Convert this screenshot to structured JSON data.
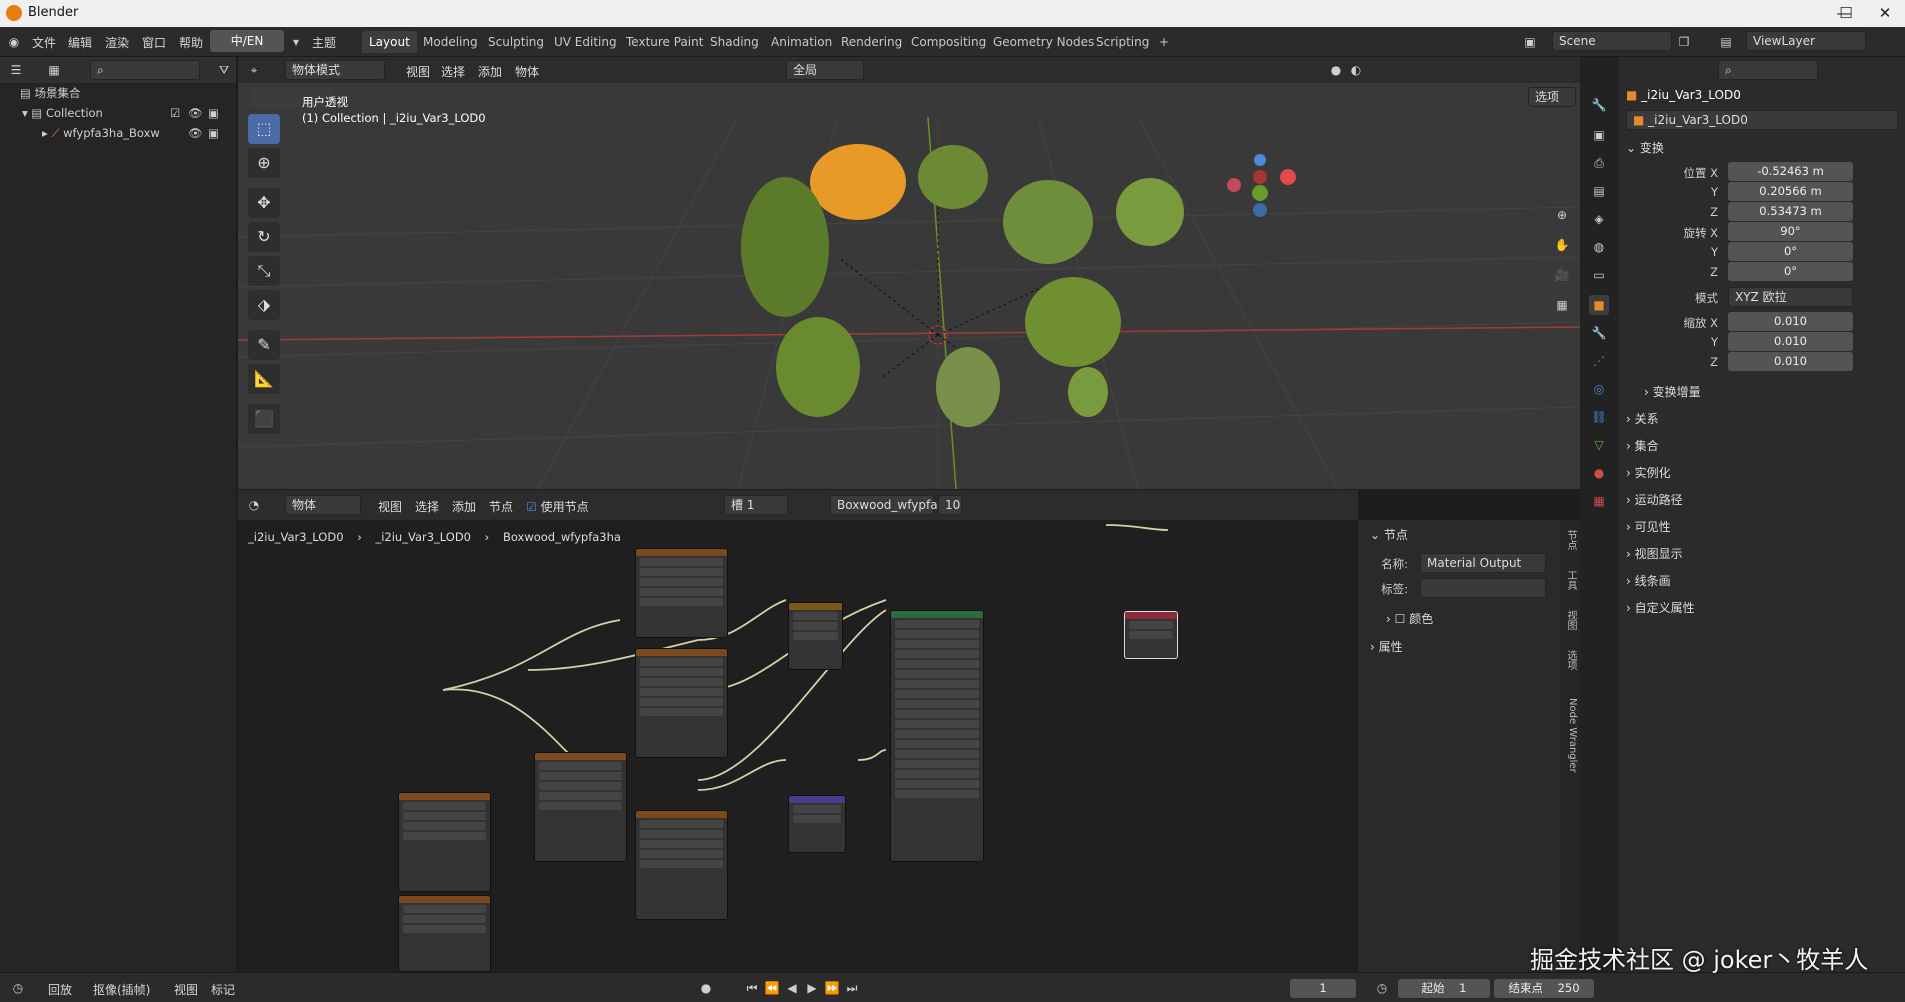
{
  "app": {
    "title": "Blender",
    "minimize": "—",
    "maximize": "☐",
    "close": "✕"
  },
  "menus": [
    "文件",
    "编辑",
    "渲染",
    "窗口",
    "帮助"
  ],
  "lang_button": "中/EN",
  "theme_menu": "主题",
  "workspaces": [
    "Layout",
    "Modeling",
    "Sculpting",
    "UV Editing",
    "Texture Paint",
    "Shading",
    "Animation",
    "Rendering",
    "Compositing",
    "Geometry Nodes",
    "Scripting"
  ],
  "add_tab": "+",
  "scene": {
    "name": "Scene",
    "view_layer": "ViewLayer"
  },
  "outliner": {
    "root": "场景集合",
    "collection": "Collection",
    "object": "wfypfa3ha_Boxw"
  },
  "viewport": {
    "mode": "物体模式",
    "menus": [
      "视图",
      "选择",
      "添加",
      "物体"
    ],
    "transform_orient": "全局",
    "options": "选项",
    "overlay_title": "用户透视",
    "overlay_sub": "(1) Collection | _i2iu_Var3_LOD0",
    "tools": [
      "select",
      "cursor",
      "move",
      "rotate",
      "scale",
      "transform",
      "annotate",
      "measure",
      "add-cube"
    ]
  },
  "node_editor": {
    "type": "物体",
    "menus": [
      "视图",
      "选择",
      "添加",
      "节点"
    ],
    "use_nodes_label": "使用节点",
    "use_nodes_checked": true,
    "slot": "槽 1",
    "material": "Boxwood_wfypfa3ha",
    "users": "10",
    "breadcrumb": [
      "_i2iu_Var3_LOD0",
      "_i2iu_Var3_LOD0",
      "Boxwood_wfypfa3ha"
    ],
    "sidebar": {
      "section": "节点",
      "name_label": "名称:",
      "name_value": "Material Output",
      "label_label": "标签:",
      "label_value": "",
      "color": "颜色",
      "props": "属性"
    },
    "tabs": [
      "节点",
      "工具",
      "视图",
      "选项",
      "Node Wrangler"
    ]
  },
  "properties": {
    "object_name": "_i2iu_Var3_LOD0",
    "data_name": "_i2iu_Var3_LOD0",
    "transform_title": "变换",
    "location": {
      "label": "位置 X",
      "x": "-0.52463 m",
      "y": "0.20566 m",
      "z": "0.53473 m"
    },
    "rotation": {
      "label": "旋转 X",
      "x": "90°",
      "y": "0°",
      "z": "0°"
    },
    "mode_label": "模式",
    "mode_value": "XYZ 欧拉",
    "scale": {
      "label": "缩放 X",
      "x": "0.010",
      "y": "0.010",
      "z": "0.010"
    },
    "y_label": "Y",
    "z_label": "Z",
    "delta": "变换增量",
    "sections": [
      "关系",
      "集合",
      "实例化",
      "运动路径",
      "可见性",
      "视图显示",
      "线条画",
      "自定义属性"
    ]
  },
  "timeline": {
    "playback": "回放",
    "keying": "抠像(插帧)",
    "view": "视图",
    "marker": "标记",
    "current": "1",
    "start_label": "起始",
    "start": "1",
    "end_label": "结束点",
    "end": "250"
  },
  "watermark": "掘金技术社区 @ joker丶牧羊人"
}
